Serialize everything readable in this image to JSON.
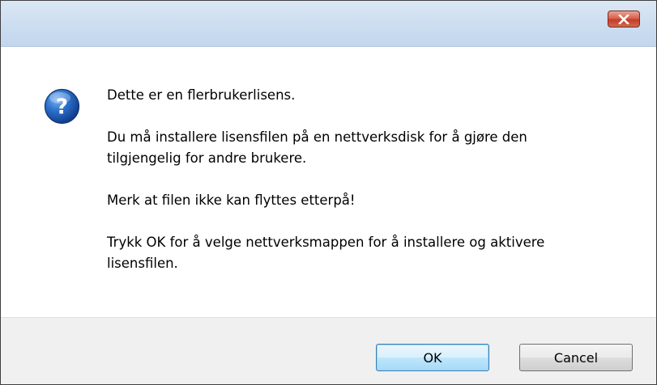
{
  "dialog": {
    "title": "",
    "close_icon": "close-icon",
    "icon": "question-icon",
    "messages": [
      "Dette er en flerbrukerlisens.",
      "Du må installere lisensfilen på en nettverksdisk for å gjøre den\ntilgjengelig for andre brukere.",
      "Merk at filen ikke kan flyttes etterpå!",
      "Trykk OK for å velge nettverksmappen for å installere og aktivere\nlisensfilen."
    ],
    "buttons": {
      "ok_label": "OK",
      "cancel_label": "Cancel"
    },
    "colors": {
      "titlebar": "#cfdff1",
      "close_button": "#c94a36",
      "footer": "#f0f0f0",
      "icon_blue": "#1d5fb8"
    }
  }
}
